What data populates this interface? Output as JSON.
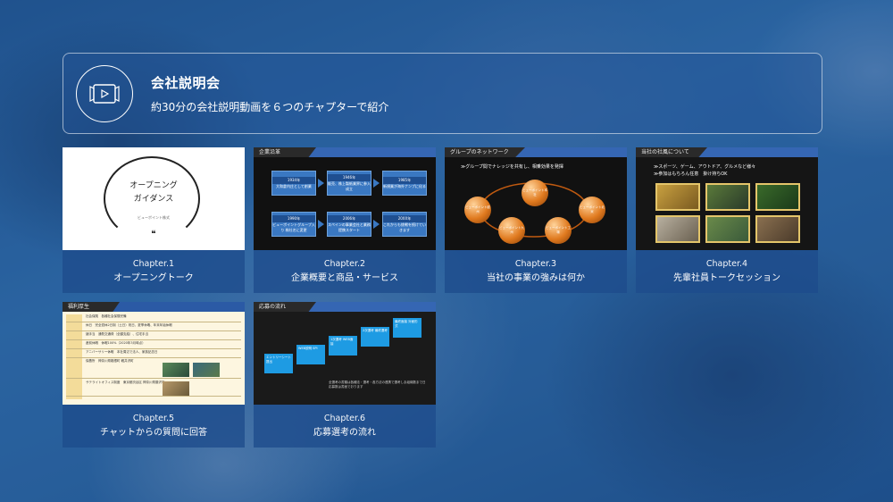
{
  "header": {
    "icon": "video-icon",
    "title": "会社説明会",
    "subtitle": "約30分の会社説明動画を６つのチャプターで紹介"
  },
  "chapters": [
    {
      "chapter": "Chapter.1",
      "title": "オープニングトーク",
      "slide": {
        "line1": "オープニング",
        "line2": "ガイダンス",
        "small": "ビューポイント株式",
        "mark": "❝"
      }
    },
    {
      "chapter": "Chapter.2",
      "title": "企業概要と商品・サービス",
      "slide": {
        "tab": "企業沿革",
        "boxes": [
          {
            "year": "1934年",
            "text": "大和倉内庄として創業"
          },
          {
            "year": "1946年",
            "text": "販売、株上製紙業界に参入成立"
          },
          {
            "year": "1985年",
            "text": "新規業が海外ナンプに化る"
          },
          {
            "year": "1990年",
            "text": "ビューポイントグループ入り 株社名に変更"
          },
          {
            "year": "2006年",
            "text": "スペインの事業会社と業務提携スタート"
          },
          {
            "year": "20XX年",
            "text": "これからも挑戦を続けていきます"
          }
        ]
      }
    },
    {
      "chapter": "Chapter.3",
      "title": "当社の事業の強みは何か",
      "slide": {
        "tab": "グループのネットワーク",
        "heading": "≫グループ間でナレッジを共有し、相乗効果を発揮",
        "nodes": [
          "ビューポイント本社",
          "ビューポイント欧州",
          "ビューポイント北米",
          "ビューポイント九州",
          "ビューポイント工場"
        ]
      }
    },
    {
      "chapter": "Chapter.4",
      "title": "先輩社員トークセッション",
      "slide": {
        "tab": "当社の社風について",
        "line1": "≫スポーツ、ゲーム、アウトドア、グルメなど様々",
        "line2": "≫参加はもちろん任意　掛け持ちOK"
      }
    },
    {
      "chapter": "Chapter.5",
      "title": "チャットからの質問に回答",
      "slide": {
        "tab": "福利厚生",
        "rows": [
          "社会保険　各種社会保険完備",
          "休日　完全週休2日制（土日）祝日、夏季休暇、年末年始休暇",
          "諸手当　通勤交通費（全額支給）、住宅手当",
          "産前休暇　休暇100%（2020年3月時点）",
          "アニバーサリー休暇　本社周辺で法人、家族記念日",
          "保養所　神奈川県箱根町 軽井沢町",
          "サテライトオフィス制度　東京都渋谷区 神奈川県藤沢市"
        ]
      }
    },
    {
      "chapter": "Chapter.6",
      "title": "応募選考の流れ",
      "slide": {
        "tab": "応募の流れ",
        "steps": [
          "エントリーシート提出",
          "WEB説明 SPI",
          "1次選考 WEB面接",
          "2次選考 最終選考",
          "最終面接 対面形式"
        ],
        "note": "全選考の書類は各種法・選考・各方法の連携で選考しま組織数まで日応募数は書面でおります"
      }
    }
  ]
}
